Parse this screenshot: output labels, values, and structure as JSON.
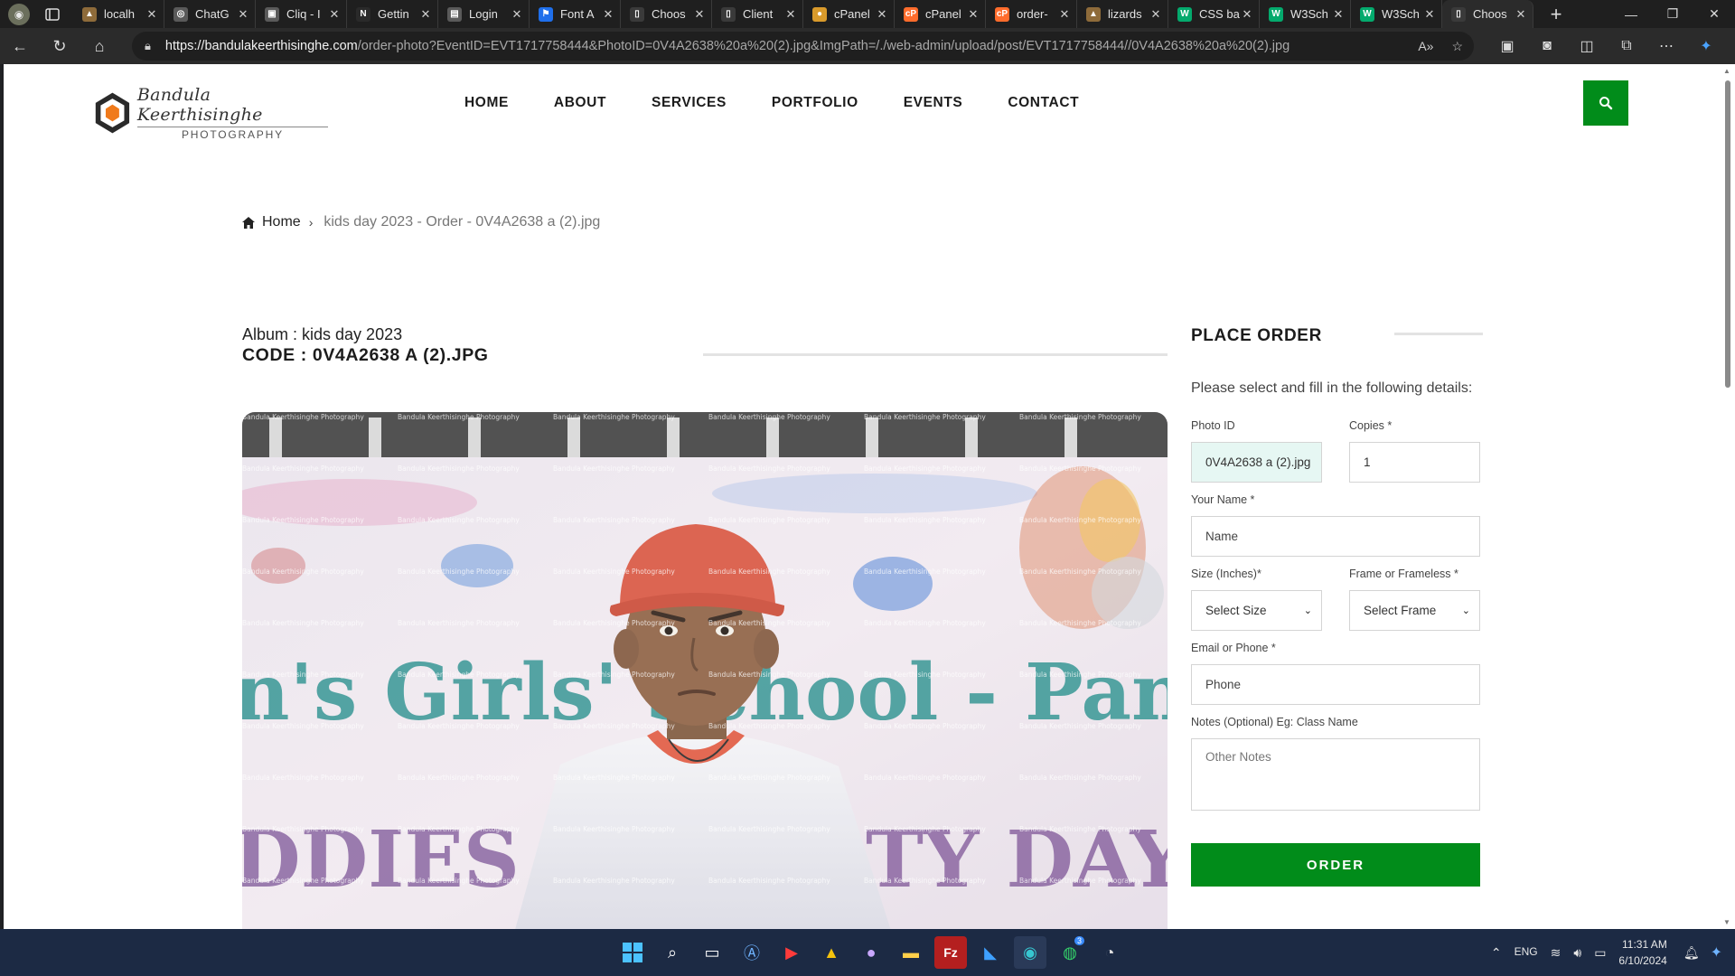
{
  "browser": {
    "tabs": [
      {
        "title": "localh",
        "fav_color": "#8e6b3a",
        "fav_glyph": "▲"
      },
      {
        "title": "ChatG",
        "fav_color": "#5a5a5a",
        "fav_glyph": "◎"
      },
      {
        "title": "Cliq - I",
        "fav_color": "#5a5a5a",
        "fav_glyph": "▣"
      },
      {
        "title": "Gettin",
        "fav_color": "#2a2a2a",
        "fav_glyph": "N"
      },
      {
        "title": "Login",
        "fav_color": "#5a5a5a",
        "fav_glyph": "▤"
      },
      {
        "title": "Font A",
        "fav_color": "#1f6feb",
        "fav_glyph": "⚑"
      },
      {
        "title": "Choos",
        "fav_color": "#3a3a3a",
        "fav_glyph": "▯"
      },
      {
        "title": "Client",
        "fav_color": "#3a3a3a",
        "fav_glyph": "▯"
      },
      {
        "title": "cPanel",
        "fav_color": "#d99a2b",
        "fav_glyph": "●"
      },
      {
        "title": "cPanel",
        "fav_color": "#ff6c2c",
        "fav_glyph": "cP"
      },
      {
        "title": "order-",
        "fav_color": "#ff6c2c",
        "fav_glyph": "cP"
      },
      {
        "title": "lizards",
        "fav_color": "#8e6b3a",
        "fav_glyph": "▲"
      },
      {
        "title": "CSS ba",
        "fav_color": "#04aa6d",
        "fav_glyph": "W"
      },
      {
        "title": "W3Sch",
        "fav_color": "#04aa6d",
        "fav_glyph": "W"
      },
      {
        "title": "W3Sch",
        "fav_color": "#04aa6d",
        "fav_glyph": "W"
      },
      {
        "title": "Choos",
        "fav_color": "#3a3a3a",
        "fav_glyph": "▯"
      }
    ],
    "url_host": "https://bandulakeerthisinghe.com",
    "url_path": "/order-photo?EventID=EVT1717758444&PhotoID=0V4A2638%20a%20(2).jpg&ImgPath=/./web-admin/upload/post/EVT1717758444//0V4A2638%20a%20(2).jpg"
  },
  "site": {
    "logo_name": "Bandula Keerthisinghe",
    "logo_sub": "PHOTOGRAPHY",
    "nav": [
      "HOME",
      "ABOUT",
      "SERVICES",
      "PORTFOLIO",
      "EVENTS",
      "CONTACT"
    ],
    "accent": "#018c1a"
  },
  "breadcrumb": {
    "home": "Home",
    "current": "kids day 2023 - Order - 0V4A2638 a (2).jpg"
  },
  "album": {
    "album_line": "Album : kids day 2023",
    "code_line": "CODE : 0V4A2638 A (2).JPG"
  },
  "photo": {
    "watermark": "Bandula Keerthisinghe Photography",
    "banner_text": "n's Girls' School - Panadu",
    "bottom_text": "DDIES",
    "bottom_text_right": "TY DAY"
  },
  "order": {
    "title": "PLACE ORDER",
    "intro": "Please select and fill in the following details:",
    "photo_id_label": "Photo ID",
    "photo_id_value": "0V4A2638 a (2).jpg",
    "copies_label": "Copies *",
    "copies_value": "1",
    "name_label": "Your Name *",
    "name_placeholder": "Name",
    "size_label": "Size (Inches)*",
    "size_value": "Select Size",
    "frame_label": "Frame or Frameless *",
    "frame_value": "Select Frame",
    "contact_label": "Email or Phone *",
    "contact_placeholder": "Phone",
    "notes_label": "Notes (Optional) Eg: Class Name",
    "notes_placeholder": "Other Notes",
    "button": "ORDER"
  },
  "taskbar": {
    "lang": "ENG",
    "time": "11:31 AM",
    "date": "6/10/2024",
    "whatsapp_badge": "3"
  }
}
